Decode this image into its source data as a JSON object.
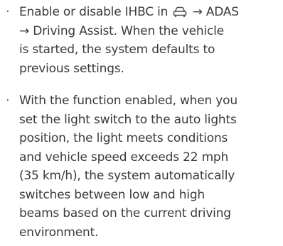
{
  "bullets": [
    {
      "lines": [
        {
          "before_icon": "Enable or disable IHBC in ",
          "icon": "car-icon",
          "after_icon": " → ADAS"
        },
        {
          "text": "→ Driving Assist. When the vehicle"
        },
        {
          "text": "is started, the system defaults to"
        },
        {
          "text": "previous settings."
        }
      ]
    },
    {
      "lines": [
        {
          "text": "With the function enabled, when you"
        },
        {
          "text": "set the light switch to the auto lights"
        },
        {
          "text": "position, the light meets conditions"
        },
        {
          "text": "and vehicle speed exceeds 22 mph"
        },
        {
          "text": "(35 km/h), the system automatically"
        },
        {
          "text": "switches between low and high"
        },
        {
          "text": "beams based on the current driving"
        },
        {
          "text": "environment."
        }
      ]
    }
  ],
  "bullet_symbol": "·",
  "colors": {
    "text": "#3a3a3a",
    "bullet": "#6a6a6a",
    "background": "#ffffff"
  }
}
